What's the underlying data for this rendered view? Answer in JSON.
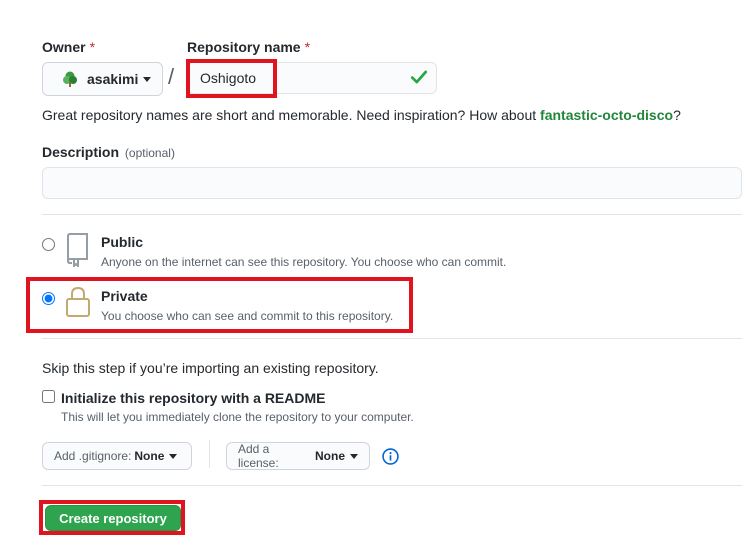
{
  "owner": {
    "label": "Owner",
    "required_mark": "*",
    "selected": "asakimi"
  },
  "repo": {
    "label": "Repository name",
    "required_mark": "*",
    "value": "Oshigoto",
    "separator": "/"
  },
  "hint": {
    "text": "Great repository names are short and memorable. Need inspiration? How about ",
    "suggestion": "fantastic-octo-disco",
    "end": "?"
  },
  "description": {
    "label": "Description",
    "optional": "(optional)",
    "value": ""
  },
  "visibility": {
    "public": {
      "title": "Public",
      "desc": "Anyone on the internet can see this repository. You choose who can commit.",
      "checked": false
    },
    "private": {
      "title": "Private",
      "desc": "You choose who can see and commit to this repository.",
      "checked": true
    }
  },
  "skip_text": "Skip this step if you’re importing an existing repository.",
  "readme": {
    "label": "Initialize this repository with a README",
    "desc": "This will let you immediately clone the repository to your computer.",
    "checked": false
  },
  "gitignore": {
    "prefix": "Add .gitignore:",
    "value": "None"
  },
  "license": {
    "prefix": "Add a license:",
    "value": "None"
  },
  "create_button": "Create repository",
  "colors": {
    "accent_green": "#2ea44f",
    "highlight_red": "#e0141f",
    "radio_blue": "#0366d6",
    "info_blue": "#0366d6"
  }
}
